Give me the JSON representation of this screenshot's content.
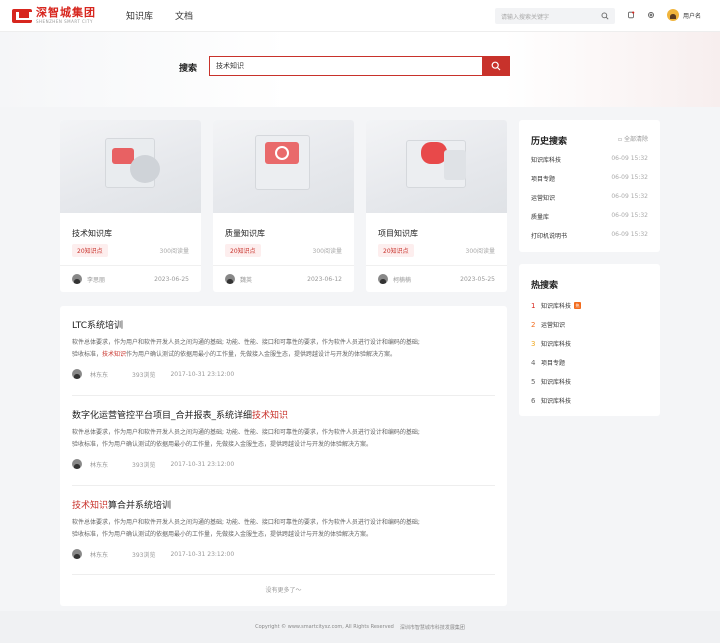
{
  "header": {
    "logo_cn": "深智城集团",
    "logo_en": "SHENZHEN SMART CITY",
    "nav": [
      "知识库",
      "文档"
    ],
    "search_placeholder": "请输入搜索关键字",
    "username": "用户名"
  },
  "search": {
    "label": "搜索",
    "value": "技术知识"
  },
  "cards": [
    {
      "title": "技术知识库",
      "tag": "20知识点",
      "reads": "300阅读量",
      "author": "李思丽",
      "date": "2023-06-25"
    },
    {
      "title": "质量知识库",
      "tag": "20知识点",
      "reads": "300阅读量",
      "author": "魏英",
      "date": "2023-06-12"
    },
    {
      "title": "项目知识库",
      "tag": "20知识点",
      "reads": "300阅读量",
      "author": "柯楠楠",
      "date": "2023-05-25"
    }
  ],
  "results": [
    {
      "title_pre": "LTC系统培训",
      "title_hl": "",
      "title_post": "",
      "desc1": "软件总体要求，作为用户和软件开发人员之间沟通的基础; 功能、性能、接口和可靠性的要求，作为软件人员进行设计和编码的基础;",
      "desc2_pre": "验收标准，",
      "desc2_hl": "技术知识",
      "desc2_post": "作为用户确认测试的依据用最小的工作量，先做接入金服生态，提供跨越设计与开发的体验解决方案。",
      "author": "林东东",
      "views": "393浏览",
      "date": "2017-10-31  23:12:00"
    },
    {
      "title_pre": "数字化运营管控平台项目_合并报表_系统详细",
      "title_hl": "技术知识",
      "title_post": "",
      "desc1": "软件总体要求，作为用户和软件开发人员之间沟通的基础; 功能、性能、接口和可靠性的要求，作为软件人员进行设计和编码的基础;",
      "desc2_pre": "验收标准，作为用户确认测试的依据用最小的工作量，先做接入金服生态，提供跨越设计与开发的体验解决方案。",
      "desc2_hl": "",
      "desc2_post": "",
      "author": "林东东",
      "views": "393浏览",
      "date": "2017-10-31  23:12:00"
    },
    {
      "title_pre": "",
      "title_hl": "技术知识",
      "title_post": "算合并系统培训",
      "desc1": "软件总体要求，作为用户和软件开发人员之间沟通的基础; 功能、性能、接口和可靠性的要求，作为软件人员进行设计和编码的基础;",
      "desc2_pre": "验收标准，作为用户确认测试的依据用最小的工作量，先做接入金服生态，提供跨越设计与开发的体验解决方案。",
      "desc2_hl": "",
      "desc2_post": "",
      "author": "林东东",
      "views": "393浏览",
      "date": "2017-10-31  23:12:00"
    }
  ],
  "no_more": "没有更多了～",
  "history": {
    "title": "历史搜索",
    "clear": "全部清除",
    "items": [
      {
        "text": "知识库科技",
        "date": "06-09 15:32"
      },
      {
        "text": "项目专题",
        "date": "06-09 15:32"
      },
      {
        "text": "运营知识",
        "date": "06-09 15:32"
      },
      {
        "text": "质量库",
        "date": "06-09 15:32"
      },
      {
        "text": "打印机说明书",
        "date": "06-09 15:32"
      }
    ]
  },
  "hot": {
    "title": "热搜索",
    "badge": "热",
    "items": [
      {
        "rank": "1",
        "text": "知识库科技",
        "color": "#d7261e"
      },
      {
        "rank": "2",
        "text": "运营知识",
        "color": "#f26b1d"
      },
      {
        "rank": "3",
        "text": "知识库科技",
        "color": "#f0a820"
      },
      {
        "rank": "4",
        "text": "项目专题",
        "color": "#666666"
      },
      {
        "rank": "5",
        "text": "知识库科技",
        "color": "#666666"
      },
      {
        "rank": "6",
        "text": "知识库科技",
        "color": "#666666"
      }
    ]
  },
  "footer": {
    "copyright": "Copyright © www.smartcitysz.com, All Rights Reserved",
    "company": "深圳市智慧城市科技发展集团"
  }
}
